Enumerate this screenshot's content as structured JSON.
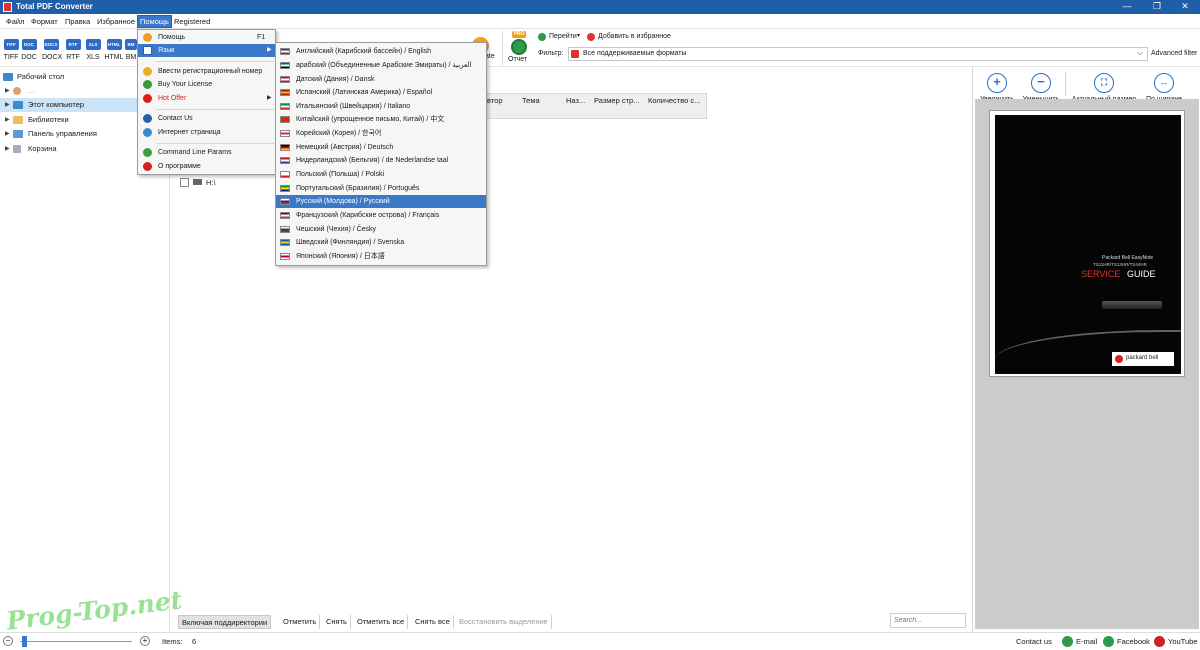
{
  "window": {
    "title": "Total PDF Converter"
  },
  "menubar": {
    "items": [
      "Файл",
      "Формат",
      "Правка",
      "Избранное",
      "Помощь",
      "Registered"
    ],
    "active": "Помощь"
  },
  "toolbar": {
    "formats": [
      "TIFF",
      "DOC",
      "DOCX",
      "RTF",
      "XLS",
      "HTML",
      "BM"
    ],
    "report_label": "Отчет",
    "pro_badge": "PRO",
    "partial_label": "ate",
    "goto_label": "Перейти",
    "favorite_label": "Добавить в избранное",
    "filter_label": "Фильтр:",
    "filter_value": "Все поддерживаемые форматы",
    "advanced_filter": "Advanced filter"
  },
  "tree": {
    "desktop": "Рабочий стол",
    "user": "...",
    "computer": "Этот компьютер",
    "libraries": "Библиотеки",
    "control_panel": "Панель управления",
    "trash": "Корзина"
  },
  "columns": [
    "Автор",
    "Тема",
    "Наз...",
    "Размер стр...",
    "Количество с..."
  ],
  "file_row": {
    "label": "H:\\"
  },
  "help_menu": {
    "items": [
      {
        "label": "Помощь",
        "shortcut": "F1",
        "icon_color": "#f0a020"
      },
      {
        "label": "Язык",
        "highlight": true
      },
      {
        "label": "Ввести регистрационный номер",
        "icon_color": "#e8b020"
      },
      {
        "label": "Buy Your License",
        "icon_color": "#3a9a3a"
      },
      {
        "label": "Hot Offer",
        "red": true,
        "icon_color": "#d32020"
      },
      {
        "label": "Contact Us",
        "icon_color": "#2a5fa8"
      },
      {
        "label": "Интернет страница",
        "icon_color": "#3a8ad0"
      },
      {
        "label": "Command Line Params",
        "icon_color": "#3aa040"
      },
      {
        "label": "О программе",
        "icon_color": "#d32020"
      }
    ]
  },
  "language_menu": {
    "items": [
      {
        "label": "Английский (Карибский бассейн) / English",
        "flag": [
          "#1c3f94",
          "#ffffff",
          "#c8102e"
        ]
      },
      {
        "label": "арабский (Объединенные Арабские Эмираты) / العربية",
        "flag": [
          "#00732f",
          "#ffffff",
          "#000000"
        ]
      },
      {
        "label": "Датский (Дания) / Dansk",
        "flag": [
          "#c60c30",
          "#ffffff",
          "#c60c30"
        ]
      },
      {
        "label": "Испанский (Латинская Америка) / Español",
        "flag": [
          "#aa151b",
          "#f1bf00",
          "#aa151b"
        ]
      },
      {
        "label": "Итальянский (Швейцария) / Italiano",
        "flag": [
          "#009246",
          "#ffffff",
          "#ce2b37"
        ]
      },
      {
        "label": "Китайский (упрощенное письмо, Китай) / 中文",
        "flag": [
          "#de2910",
          "#de2910",
          "#de2910"
        ]
      },
      {
        "label": "Корейский (Корея) / 한국어",
        "flag": [
          "#ffffff",
          "#cd2e3a",
          "#ffffff"
        ]
      },
      {
        "label": "Немецкий (Австрия) / Deutsch",
        "flag": [
          "#000000",
          "#dd0000",
          "#ffce00"
        ]
      },
      {
        "label": "Нидерландский (Бельгия) / de Nederlandse taal",
        "flag": [
          "#ae1c28",
          "#ffffff",
          "#21468b"
        ]
      },
      {
        "label": "Польский (Польша) / Polski",
        "flag": [
          "#ffffff",
          "#ffffff",
          "#dc143c"
        ]
      },
      {
        "label": "Португальский (Бразилия) / Português",
        "flag": [
          "#009c3b",
          "#ffdf00",
          "#002776"
        ]
      },
      {
        "label": "Русский (Молдова) / Русский",
        "flag": [
          "#ffffff",
          "#0039a6",
          "#d52b1e"
        ],
        "highlight": true
      },
      {
        "label": "Французский (Карибские острова) / Français",
        "flag": [
          "#002395",
          "#ffffff",
          "#ed2939"
        ]
      },
      {
        "label": "Чешский (Чехия) / Česky",
        "flag": [
          "#ffffff",
          "#11457e",
          "#d7141a"
        ]
      },
      {
        "label": "Шведский (Финляндия) / Svenska",
        "flag": [
          "#006aa7",
          "#fecc00",
          "#006aa7"
        ]
      },
      {
        "label": "Японский (Япония) / 日本語",
        "flag": [
          "#ffffff",
          "#bc002d",
          "#ffffff"
        ]
      }
    ]
  },
  "preview": {
    "zoom_in": "Увеличить",
    "zoom_out": "Уменьшить",
    "actual_size": "Актуальный размер",
    "fit_width": "По ширине",
    "doc_line1": "Packard Bell EasyNote",
    "doc_line2": "TS11HR/TS13HR/TS44HR",
    "doc_title_a": "SERVICE",
    "doc_title_b": "GUIDE",
    "doc_logo": "packard bell"
  },
  "bottom_buttons": [
    "Включая поддиректории",
    "Отметить",
    "Снять",
    "Отметить все",
    "Снять все",
    "Восстановить выделение"
  ],
  "search": {
    "placeholder": "Search..."
  },
  "status": {
    "items_label": "Items:",
    "items_count": "6",
    "contact": "Contact us",
    "email": "E-mail",
    "facebook": "Facebook",
    "youtube": "YouTube"
  },
  "watermark": "Prog-Top.net"
}
